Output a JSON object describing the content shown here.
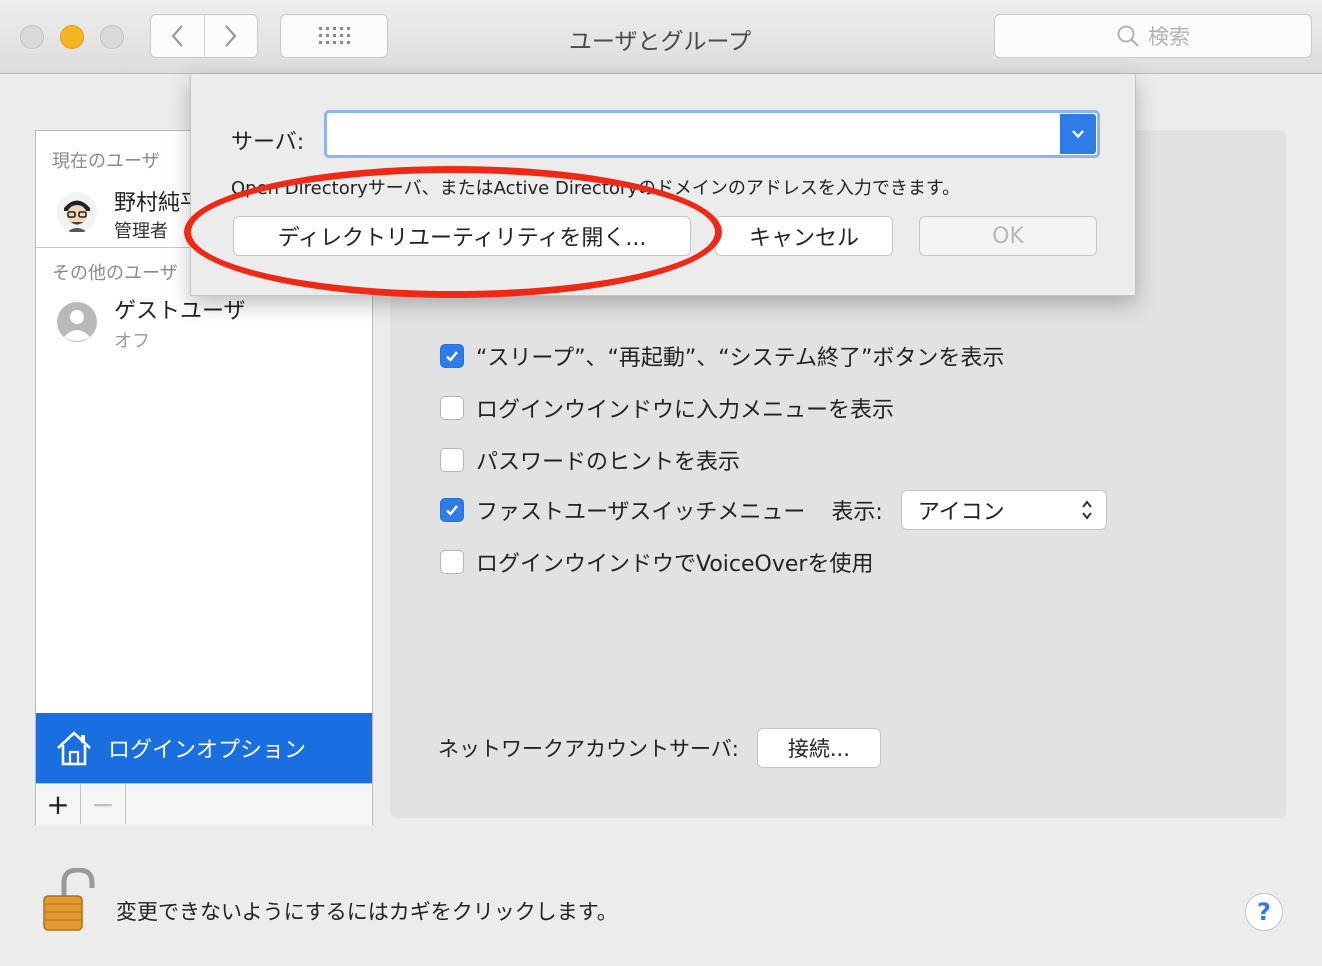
{
  "window": {
    "title": "ユーザとグループ",
    "search_placeholder": "検索"
  },
  "sidebar": {
    "current_users_header": "現在のユーザ",
    "current_user": {
      "name": "野村純平",
      "role": "管理者"
    },
    "other_users_header": "その他のユーザ",
    "guest_user": {
      "name": "ゲストユーザ",
      "status": "オフ"
    },
    "login_options_label": "ログインオプション",
    "add_label": "+",
    "remove_label": "−"
  },
  "main": {
    "checkboxes": [
      {
        "label": "“スリープ”、“再起動”、“システム終了”ボタンを表示",
        "checked": true
      },
      {
        "label": "ログインウインドウに入力メニューを表示",
        "checked": false
      },
      {
        "label": "パスワードのヒントを表示",
        "checked": false
      },
      {
        "label": "ファストユーザスイッチメニュー",
        "checked": true
      },
      {
        "label": "ログインウインドウでVoiceOverを使用",
        "checked": false
      }
    ],
    "display_label": "表示:",
    "display_value": "アイコン",
    "network_server_label": "ネットワークアカウントサーバ:",
    "connect_button": "接続..."
  },
  "footer": {
    "lock_text": "変更できないようにするにはカギをクリックします。",
    "help_label": "?"
  },
  "sheet": {
    "server_label": "サーバ:",
    "server_value": "",
    "hint": "Open Directoryサーバ、またはActive Directoryのドメインのアドレスを入力できます。",
    "open_directory_utility_button": "ディレクトリユーティリティを開く...",
    "cancel_button": "キャンセル",
    "ok_button": "OK"
  },
  "colors": {
    "accent": "#2f7ce8",
    "selection": "#1a6fe0",
    "highlight_ring": "#ee2a17",
    "traffic_yellow": "#f5b521"
  }
}
